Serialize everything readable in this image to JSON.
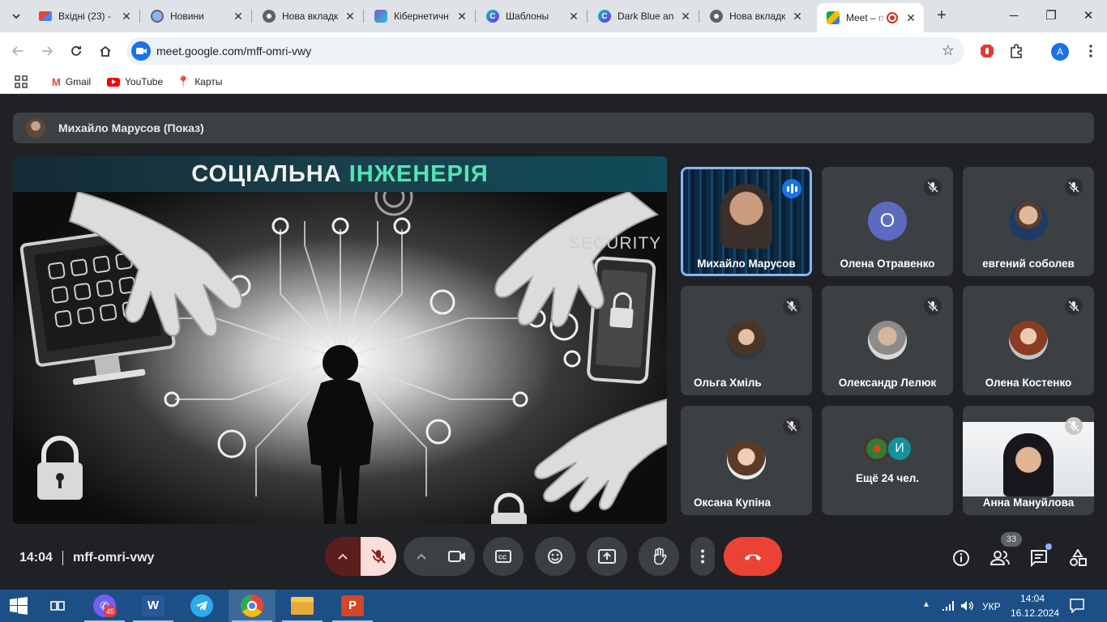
{
  "browser": {
    "tabs": [
      {
        "title": "Вхідні (23) -",
        "icon": "gmail-icon"
      },
      {
        "title": "Новини",
        "icon": "globe-icon"
      },
      {
        "title": "Нова вкладк",
        "icon": "chrome-icon"
      },
      {
        "title": "Кібернетичн",
        "icon": "app-icon"
      },
      {
        "title": "Шаблоны",
        "icon": "canva-icon"
      },
      {
        "title": "Dark Blue an",
        "icon": "canva-icon"
      },
      {
        "title": "Нова вкладк",
        "icon": "chrome-icon"
      },
      {
        "title": "Meet – m",
        "icon": "meet-icon",
        "active": true
      }
    ],
    "url": "meet.google.com/mff-omri-vwy",
    "profile_initial": "A",
    "bookmarks": [
      {
        "label": "Gmail"
      },
      {
        "label": "YouTube"
      },
      {
        "label": "Карты"
      }
    ]
  },
  "meet": {
    "presenter_banner": "Михайло Марусов (Показ)",
    "slide": {
      "title_part1": "СОЦІАЛЬНА",
      "title_part2": "ІНЖЕНЕРІЯ",
      "security_text": "SECURITY"
    },
    "participants": [
      {
        "name": "Михайло Марусов",
        "speaking": true
      },
      {
        "name": "Олена Отравенко",
        "initial": "О",
        "color": "#5c6bc0"
      },
      {
        "name": "евгений соболев"
      },
      {
        "name": "Ольга Хміль"
      },
      {
        "name": "Олександр Лелюк"
      },
      {
        "name": "Олена Костенко"
      },
      {
        "name": "Оксана Купіна"
      },
      {
        "name": "Ещё 24 чел.",
        "initial": "И",
        "color": "#12939a"
      },
      {
        "name": "Анна Мануйлова"
      }
    ],
    "clock": "14:04",
    "meeting_code": "mff-omri-vwy",
    "participant_count": "33"
  },
  "taskbar": {
    "viber_badge": "45",
    "language": "УКР",
    "time": "14:04",
    "date": "16.12.2024"
  },
  "colors": {
    "meet_bg": "#202124",
    "tile_bg": "#3c4043",
    "hangup_red": "#ea4335",
    "mic_off_bg": "#f9dedc",
    "speaking_border": "#8ab4f8",
    "slide_accent": "#55e3b9"
  }
}
